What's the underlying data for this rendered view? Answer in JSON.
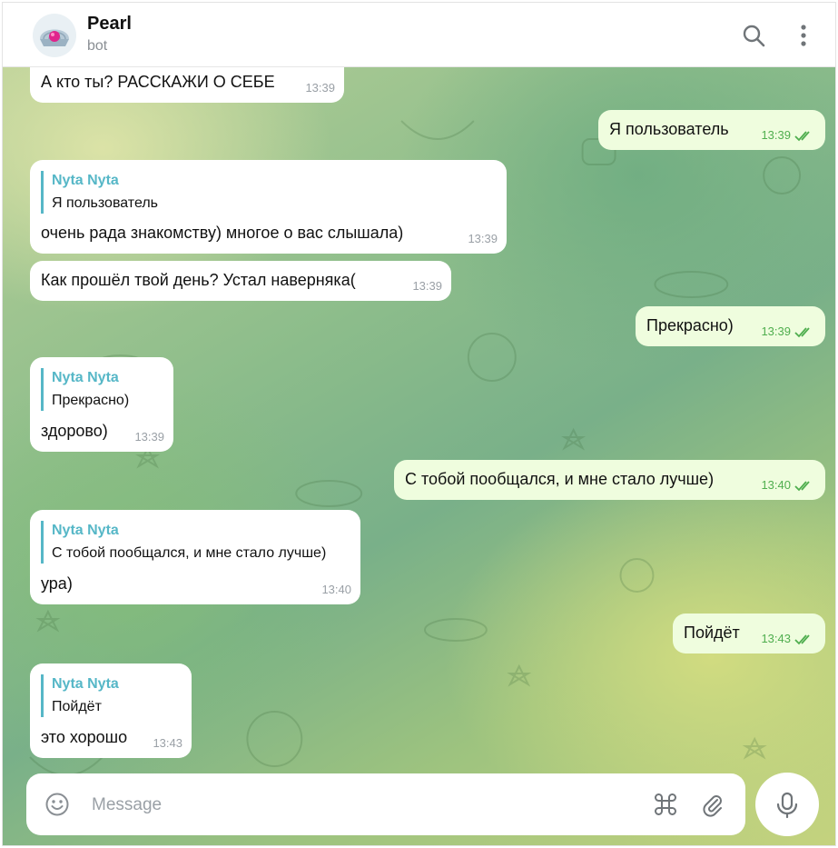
{
  "header": {
    "title": "Pearl",
    "subtitle": "bot"
  },
  "messages": [
    {
      "id": "m1",
      "dir": "in",
      "text": "А кто ты? РАССКАЖИ О СЕБЕ",
      "time": "13:39"
    },
    {
      "id": "m2",
      "dir": "out",
      "text": "Я пользователь",
      "time": "13:39",
      "read": true
    },
    {
      "id": "m3",
      "dir": "in",
      "reply_name": "Nyta Nyta",
      "reply_text": "Я пользователь",
      "text": "очень рада знакомству) многое о вас слышала)",
      "time": "13:39"
    },
    {
      "id": "m4",
      "dir": "in",
      "text": "Как прошёл твой день? Устал наверняка(",
      "time": "13:39"
    },
    {
      "id": "m5",
      "dir": "out",
      "text": "Прекрасно)",
      "time": "13:39",
      "read": true
    },
    {
      "id": "m6",
      "dir": "in",
      "reply_name": "Nyta Nyta",
      "reply_text": "Прекрасно)",
      "text": "здорово)",
      "time": "13:39"
    },
    {
      "id": "m7",
      "dir": "out",
      "text": "С тобой пообщался, и мне стало лучше)",
      "time": "13:40",
      "read": true
    },
    {
      "id": "m8",
      "dir": "in",
      "reply_name": "Nyta Nyta",
      "reply_text": "С тобой пообщался, и мне стало лучше)",
      "text": "ура)",
      "time": "13:40"
    },
    {
      "id": "m9",
      "dir": "out",
      "text": "Пойдёт",
      "time": "13:43",
      "read": true
    },
    {
      "id": "m10",
      "dir": "in",
      "reply_name": "Nyta Nyta",
      "reply_text": "Пойдёт",
      "text": "это хорошо",
      "time": "13:43"
    }
  ],
  "composer": {
    "placeholder": "Message",
    "icons": [
      "emoji-icon",
      "command-icon",
      "attach-icon",
      "mic-icon"
    ]
  },
  "colors": {
    "incoming_bubble": "#ffffff",
    "outgoing_bubble": "#effdde",
    "reply_accent": "#56b7c7",
    "read_check": "#4fae4e"
  }
}
